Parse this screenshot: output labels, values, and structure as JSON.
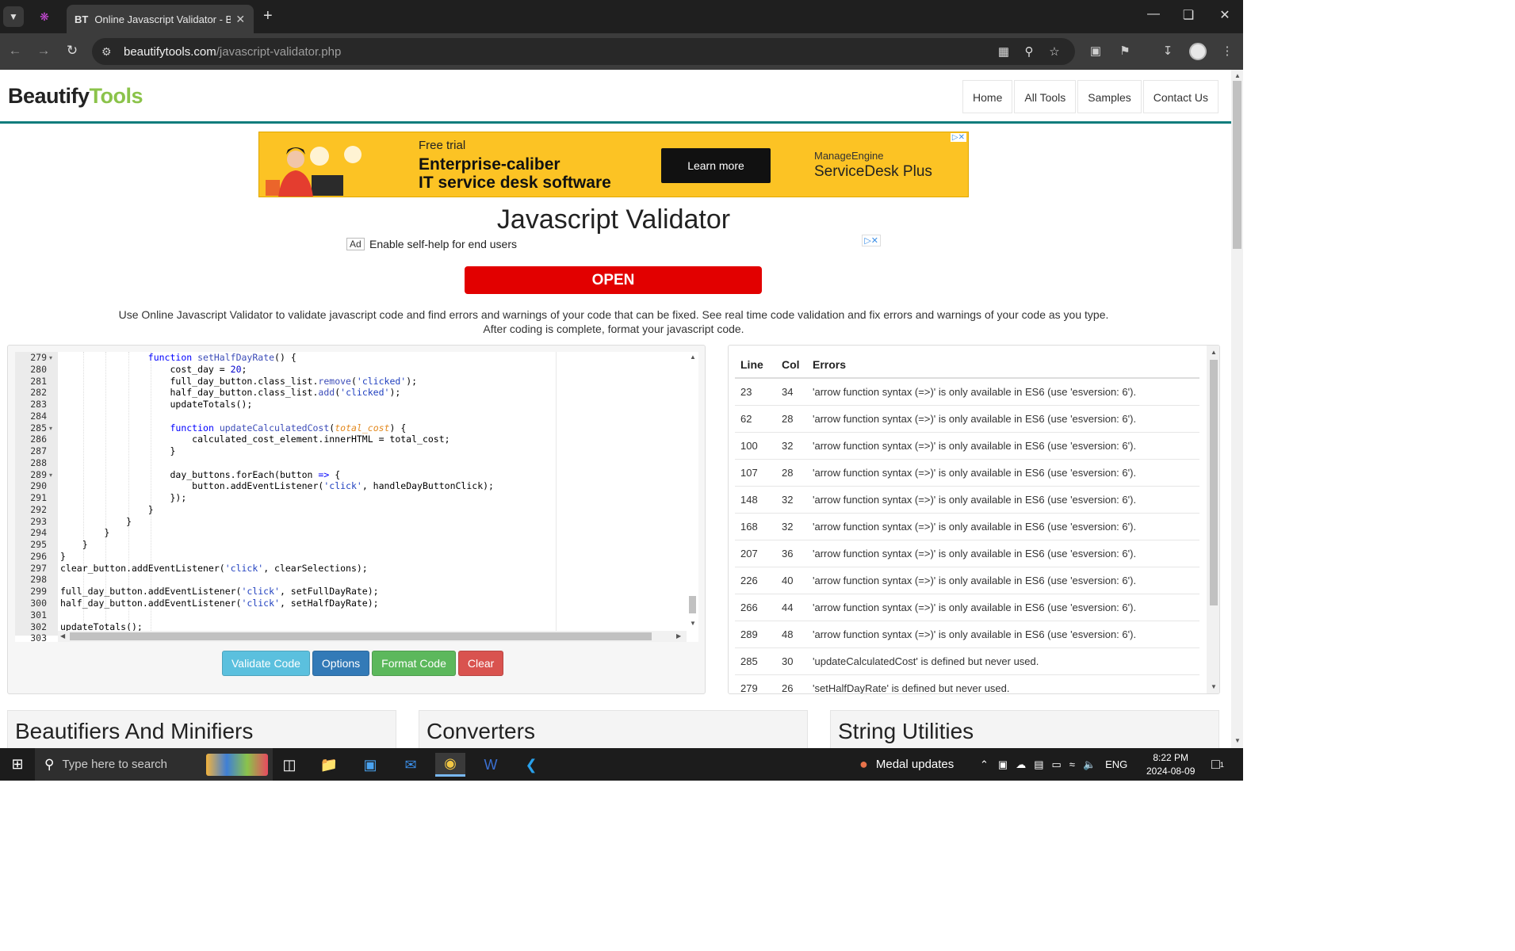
{
  "browser": {
    "tab_title": "Online Javascript Validator - Be",
    "tab_favicon": "BT",
    "url_host": "beautifytools.com",
    "url_path": "/javascript-validator.php"
  },
  "site": {
    "logo_part1": "Beautify",
    "logo_part2": "Tools",
    "nav": [
      "Home",
      "All Tools",
      "Samples",
      "Contact Us"
    ]
  },
  "ad_banner": {
    "free_trial": "Free trial",
    "headline_1": "Enterprise-caliber",
    "headline_2": "IT service desk software",
    "cta": "Learn more",
    "brand_top": "ManageEngine",
    "brand": "ServiceDesk Plus"
  },
  "page_title": "Javascript Validator",
  "ad2": {
    "tag": "Ad",
    "text": "Enable self-help for end users",
    "cta": "OPEN"
  },
  "description": "Use Online Javascript Validator to validate javascript code and find errors and warnings of your code that can be fixed. See real time code validation and fix errors and warnings of your code as you type. After coding is complete, format your javascript code.",
  "editor": {
    "line_numbers": [
      "279",
      "280",
      "281",
      "282",
      "283",
      "284",
      "285",
      "286",
      "287",
      "288",
      "289",
      "290",
      "291",
      "292",
      "293",
      "294",
      "295",
      "296",
      "297",
      "298",
      "299",
      "300",
      "301",
      "302",
      "303"
    ]
  },
  "buttons": {
    "validate": "Validate Code",
    "options": "Options",
    "format": "Format Code",
    "clear": "Clear"
  },
  "errors": {
    "headers": [
      "Line",
      "Col",
      "Errors"
    ],
    "rows": [
      {
        "line": "23",
        "col": "34",
        "msg": "'arrow function syntax (=>)' is only available in ES6 (use 'esversion: 6')."
      },
      {
        "line": "62",
        "col": "28",
        "msg": "'arrow function syntax (=>)' is only available in ES6 (use 'esversion: 6')."
      },
      {
        "line": "100",
        "col": "32",
        "msg": "'arrow function syntax (=>)' is only available in ES6 (use 'esversion: 6')."
      },
      {
        "line": "107",
        "col": "28",
        "msg": "'arrow function syntax (=>)' is only available in ES6 (use 'esversion: 6')."
      },
      {
        "line": "148",
        "col": "32",
        "msg": "'arrow function syntax (=>)' is only available in ES6 (use 'esversion: 6')."
      },
      {
        "line": "168",
        "col": "32",
        "msg": "'arrow function syntax (=>)' is only available in ES6 (use 'esversion: 6')."
      },
      {
        "line": "207",
        "col": "36",
        "msg": "'arrow function syntax (=>)' is only available in ES6 (use 'esversion: 6')."
      },
      {
        "line": "226",
        "col": "40",
        "msg": "'arrow function syntax (=>)' is only available in ES6 (use 'esversion: 6')."
      },
      {
        "line": "266",
        "col": "44",
        "msg": "'arrow function syntax (=>)' is only available in ES6 (use 'esversion: 6')."
      },
      {
        "line": "289",
        "col": "48",
        "msg": "'arrow function syntax (=>)' is only available in ES6 (use 'esversion: 6')."
      },
      {
        "line": "285",
        "col": "30",
        "msg": "'updateCalculatedCost' is defined but never used."
      },
      {
        "line": "279",
        "col": "26",
        "msg": "'setHalfDayRate' is defined but never used."
      }
    ]
  },
  "sections": [
    "Beautifiers And Minifiers",
    "Converters",
    "String Utilities"
  ],
  "taskbar": {
    "search_placeholder": "Type here to search",
    "medal_text": "Medal updates",
    "language": "ENG",
    "time": "8:22 PM",
    "date": "2024-08-09",
    "notification_count": "1"
  }
}
